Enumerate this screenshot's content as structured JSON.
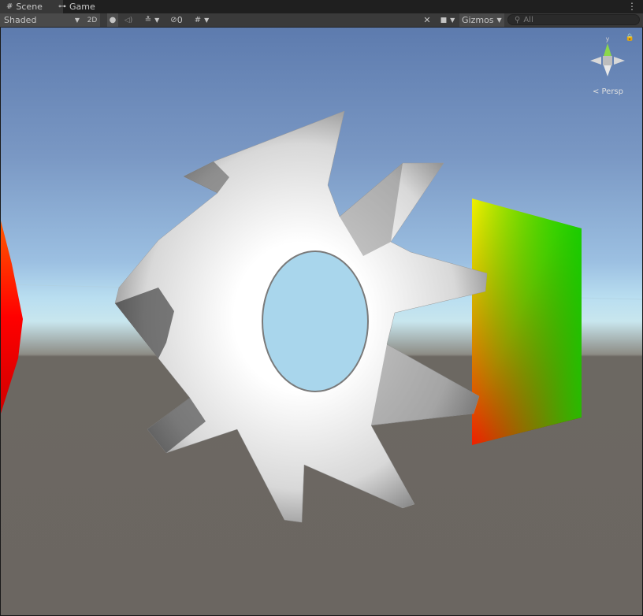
{
  "tabs": [
    {
      "label": "Scene",
      "icon": "grid-icon",
      "active": true
    },
    {
      "label": "Game",
      "icon": "gamepad-icon",
      "active": false
    }
  ],
  "toolbar": {
    "draw_mode": "Shaded",
    "mode_2d": "2D",
    "hidden_count": "0",
    "gizmos_label": "Gizmos",
    "search_placeholder": "All"
  },
  "scene": {
    "gizmo_axis_label": "y",
    "projection_label": "< Persp"
  },
  "colors": {
    "sky_top": "#5d7bae",
    "horizon": "#c8e6ee",
    "ground": "#6b6661"
  }
}
